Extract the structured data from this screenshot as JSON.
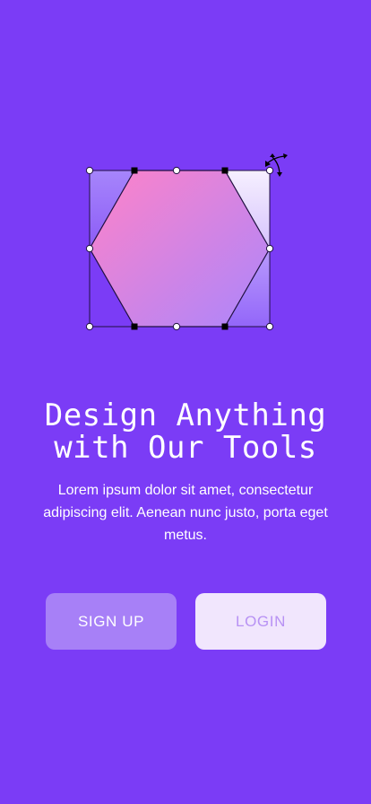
{
  "onboarding": {
    "title_line1": "Design Anything",
    "title_line2": "with Our Tools",
    "description": "Lorem ipsum dolor sit amet, consectetur adipiscing elit. Aenean nunc justo, porta eget metus.",
    "signup_label": "SIGN UP",
    "login_label": "LOGIN"
  },
  "illustration": {
    "shape": "hexagon",
    "icon": "move-cursor-icon"
  },
  "colors": {
    "background": "#7b3cf6",
    "signup_button": "#a780f7",
    "login_button": "#f1e6fd",
    "login_text": "#b892f4",
    "hexagon_gradient_start": "#ff82c8",
    "hexagon_gradient_end": "#b18afc"
  }
}
